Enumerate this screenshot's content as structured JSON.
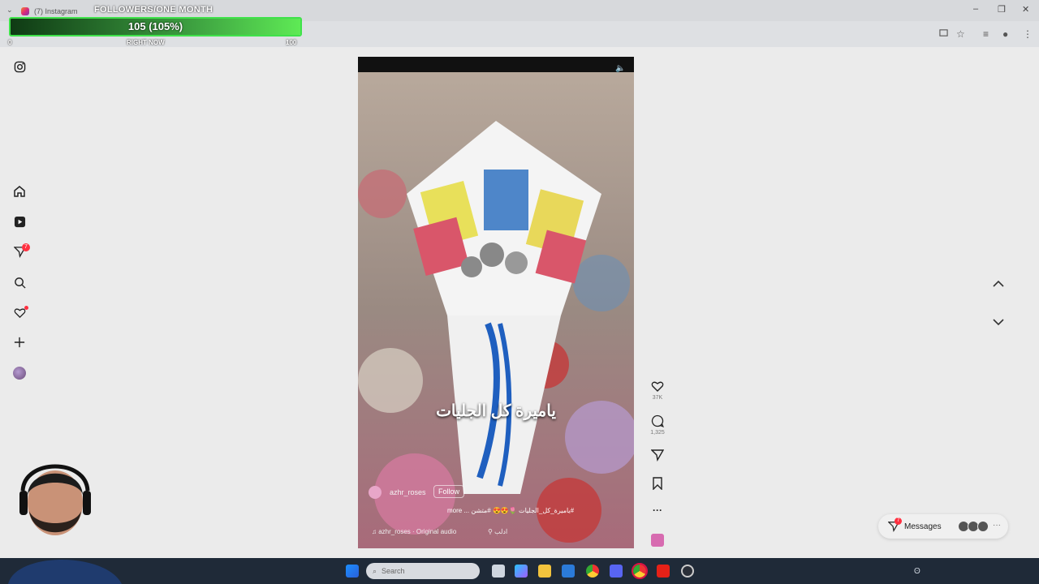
{
  "browser": {
    "tab_title": "(7) Instagram",
    "minimize_glyph": "–",
    "restore_glyph": "❐",
    "close_glyph": "✕"
  },
  "overlay": {
    "title": "FOLLOWERS/ONE MONTH",
    "value_text": "105 (105%)",
    "progress_fraction": 1.0,
    "min_label": "0",
    "center_label": "RIGHT NOW",
    "max_label": "100",
    "bar_color": "#5eea55"
  },
  "left_nav": {
    "notifications_badge": "7"
  },
  "reel": {
    "caption_arabic": "ياميرة كل الجليات",
    "username": "azhr_roses",
    "follow_label": "Follow",
    "description": "#ياميرة_كل_الجليات 🌷😍😍 #متشن ... more",
    "audio": "azhr_roses · Original audio",
    "location": "ادلب"
  },
  "actions": {
    "likes_count": "37K",
    "comments_count": "1,325"
  },
  "messages": {
    "label": "Messages",
    "badge": "7"
  },
  "taskbar": {
    "search_placeholder": "Search"
  },
  "colors": {
    "accent_red": "#ff3040",
    "overlay_green": "#3fe24a"
  }
}
